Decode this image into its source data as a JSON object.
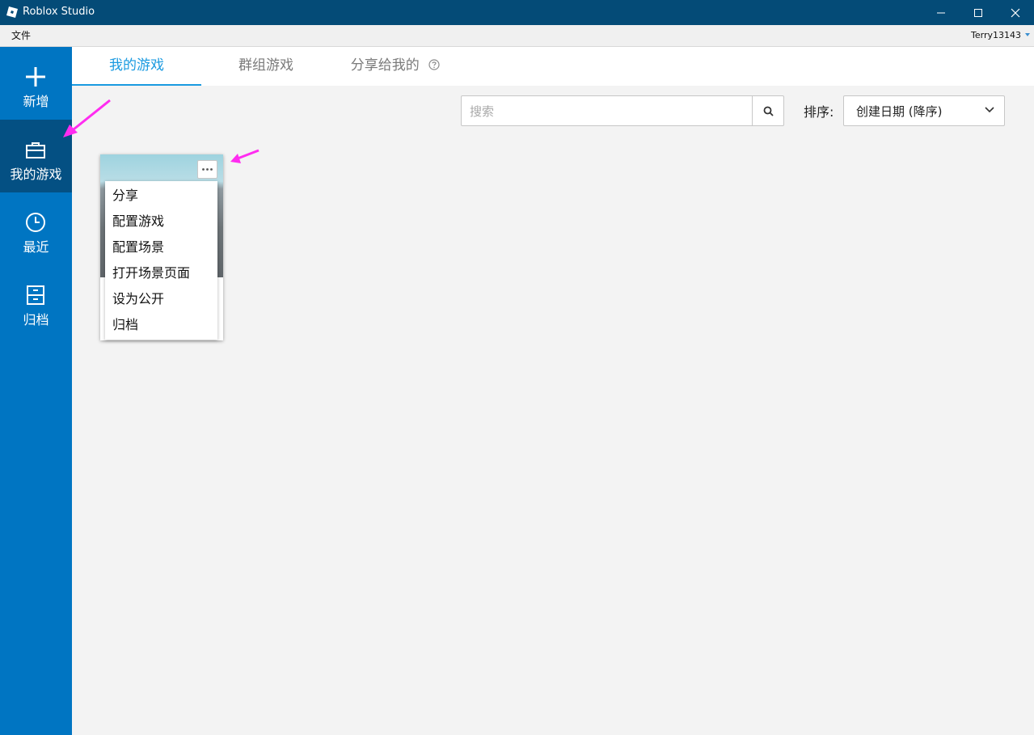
{
  "window": {
    "title": "Roblox Studio",
    "user": "Terry13143"
  },
  "menubar": {
    "file": "文件"
  },
  "sidebar": {
    "items": [
      {
        "label": "新增",
        "icon": "plus-icon"
      },
      {
        "label": "我的游戏",
        "icon": "briefcase-icon",
        "active": true
      },
      {
        "label": "最近",
        "icon": "clock-icon"
      },
      {
        "label": "归档",
        "icon": "archive-icon"
      }
    ]
  },
  "tabs": [
    {
      "label": "我的游戏",
      "active": true
    },
    {
      "label": "群组游戏"
    },
    {
      "label": "分享给我的"
    }
  ],
  "search": {
    "placeholder": "搜索"
  },
  "sort": {
    "label": "排序:",
    "value": "创建日期 (降序)"
  },
  "context_menu": {
    "items": [
      "分享",
      "配置游戏",
      "配置场景",
      "打开场景页面",
      "设为公开",
      "归档"
    ]
  },
  "colors": {
    "titlebar": "#044b77",
    "sidebar": "#0075c2",
    "sidebar_active": "#045083",
    "accent": "#1a9ae0",
    "annotation": "#ff2cf0"
  }
}
